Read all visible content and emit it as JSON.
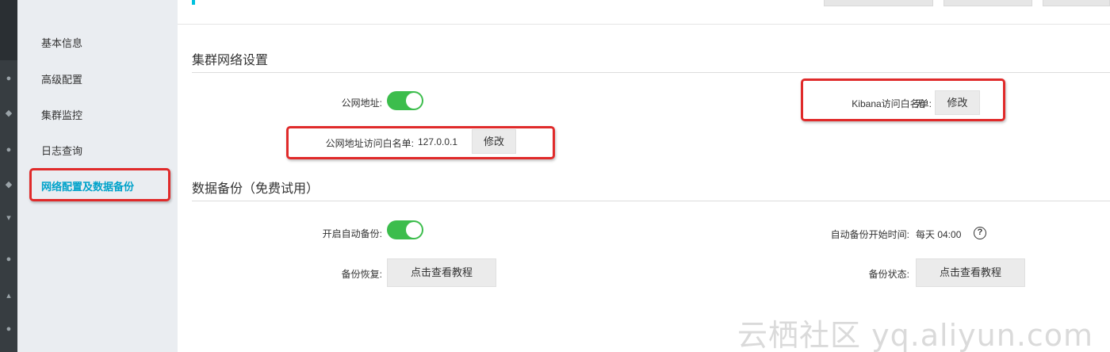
{
  "sidebar": {
    "items": [
      {
        "label": "基本信息"
      },
      {
        "label": "高级配置"
      },
      {
        "label": "集群监控"
      },
      {
        "label": "日志查询"
      },
      {
        "label": "网络配置及数据备份",
        "active": true
      }
    ]
  },
  "network": {
    "title": "集群网络设置",
    "public_label": "公网地址:",
    "public_enabled": true,
    "whitelist_label": "公网地址访问白名单:",
    "whitelist_value": "127.0.0.1",
    "whitelist_edit": "修改",
    "kibana_label": "Kibana访问白名单:",
    "kibana_value": "无",
    "kibana_edit": "修改"
  },
  "backup": {
    "title": "数据备份（免费试用）",
    "auto_label": "开启自动备份:",
    "auto_enabled": true,
    "start_label": "自动备份开始时间:",
    "start_value": "每天 04:00",
    "help_glyph": "?",
    "restore_label": "备份恢复:",
    "restore_button": "点击查看教程",
    "status_label": "备份状态:",
    "status_button": "点击查看教程"
  },
  "watermark": "云栖社区 yq.aliyun.com",
  "colors": {
    "accent": "#00a2ca",
    "toggle_on": "#3cbd4c",
    "highlight_box": "#e02a2a"
  }
}
